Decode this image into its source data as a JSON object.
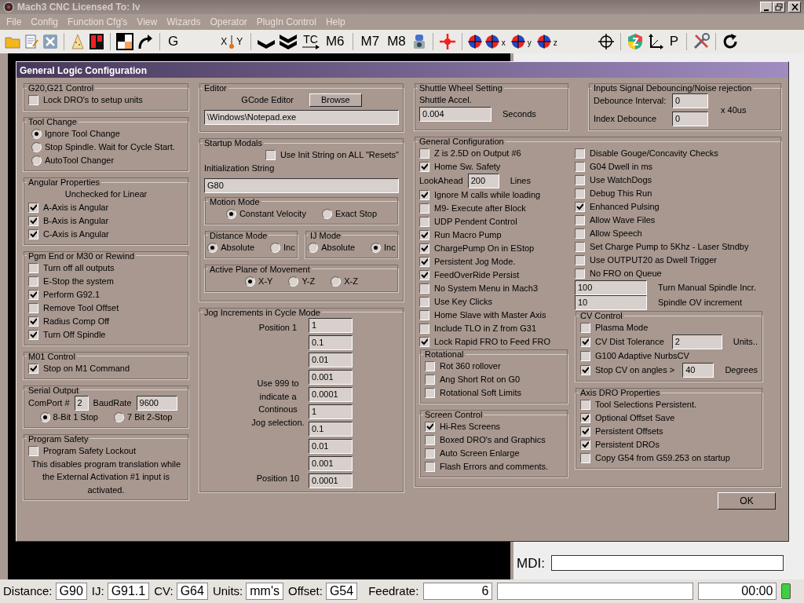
{
  "app": {
    "title": "Mach3 CNC  Licensed To: lv",
    "menu": [
      "File",
      "Config",
      "Function Cfg's",
      "View",
      "Wizards",
      "Operator",
      "PlugIn Control",
      "Help"
    ],
    "toolbar_texts": [
      "G",
      "X",
      "Y",
      "TC",
      "M6",
      "M7",
      "M8",
      "x",
      "y",
      "z",
      "P"
    ]
  },
  "dialog": {
    "title": "General Logic Configuration",
    "columns": [
      [
        {
          "title": "G20,G21 Control",
          "items": [
            {
              "kind": "check",
              "label": "Lock DRO's to setup units",
              "checked": false
            }
          ]
        },
        {
          "title": "Tool Change",
          "items": [
            {
              "kind": "radio",
              "label": "Ignore Tool Change",
              "selected": true
            },
            {
              "kind": "radio",
              "label": "Stop Spindle. Wait for Cycle Start.",
              "selected": false
            },
            {
              "kind": "radio",
              "label": "AutoTool Changer",
              "selected": false
            }
          ]
        },
        {
          "title": "Angular Properties",
          "items": [
            {
              "kind": "note",
              "text": "Unchecked for Linear"
            },
            {
              "kind": "check",
              "label": "A-Axis is Angular",
              "checked": true
            },
            {
              "kind": "check",
              "label": "B-Axis is Angular",
              "checked": true
            },
            {
              "kind": "check",
              "label": "C-Axis is Angular",
              "checked": true
            }
          ]
        },
        {
          "title": "Pgm End or M30 or Rewind",
          "items": [
            {
              "kind": "check",
              "label": "Turn off all outputs",
              "checked": false
            },
            {
              "kind": "check",
              "label": "E-Stop the system",
              "checked": false
            },
            {
              "kind": "check",
              "label": "Perform G92.1",
              "checked": true
            },
            {
              "kind": "check",
              "label": "Remove Tool Offset",
              "checked": false
            },
            {
              "kind": "check",
              "label": "Radius Comp Off",
              "checked": true
            },
            {
              "kind": "check",
              "label": "Turn Off Spindle",
              "checked": true
            }
          ]
        },
        {
          "title": "M01 Control",
          "items": [
            {
              "kind": "check",
              "label": "Stop on M1 Command",
              "checked": true
            }
          ]
        },
        {
          "title": "Serial Output",
          "items": [
            {
              "kind": "fieldrow",
              "fields": [
                {
                  "label": "ComPort #",
                  "value": "2"
                },
                {
                  "label": "BaudRate",
                  "value": "9600"
                }
              ]
            },
            {
              "kind": "radiorow",
              "options": [
                {
                  "label": "8-Bit 1 Stop",
                  "selected": true
                },
                {
                  "label": "7 Bit 2-Stop",
                  "selected": false
                }
              ]
            }
          ]
        },
        {
          "title": "Program Safety",
          "items": [
            {
              "kind": "check",
              "label": "Program Safety Lockout",
              "checked": false
            },
            {
              "kind": "note",
              "text": "This disables program translation while the External Activation #1 input is activated."
            }
          ]
        }
      ],
      [
        {
          "title": "Editor",
          "items": [
            {
              "kind": "buttonrow",
              "label": "GCode Editor",
              "button": "Browse"
            },
            {
              "kind": "input",
              "value": "\\Windows\\Notepad.exe"
            }
          ]
        },
        {
          "title": "Startup Modals",
          "items": [
            {
              "kind": "endcheck",
              "label": "Use Init String on ALL  \"Resets\"",
              "checked": false
            },
            {
              "kind": "label",
              "text": "Initialization String"
            },
            {
              "kind": "input",
              "value": "G80"
            },
            {
              "kind": "group",
              "title": "Motion Mode",
              "items": [
                {
                  "kind": "radiorow",
                  "options": [
                    {
                      "label": "Constant Velocity",
                      "selected": true
                    },
                    {
                      "label": "Exact Stop",
                      "selected": false
                    }
                  ]
                }
              ]
            },
            {
              "kind": "groups",
              "groups": [
                {
                  "title": "Distance Mode",
                  "items": [
                    {
                      "kind": "radiorow",
                      "options": [
                        {
                          "label": "Absolute",
                          "selected": true
                        },
                        {
                          "label": "Inc",
                          "selected": false
                        }
                      ]
                    }
                  ]
                },
                {
                  "title": "IJ Mode",
                  "items": [
                    {
                      "kind": "radiorow",
                      "options": [
                        {
                          "label": "Absolute",
                          "selected": false
                        },
                        {
                          "label": "Inc",
                          "selected": true
                        }
                      ]
                    }
                  ]
                }
              ]
            },
            {
              "kind": "group",
              "title": "Active Plane of Movement",
              "items": [
                {
                  "kind": "radiorow",
                  "options": [
                    {
                      "label": "X-Y",
                      "selected": true
                    },
                    {
                      "label": "Y-Z",
                      "selected": false
                    },
                    {
                      "label": "X-Z",
                      "selected": false
                    }
                  ]
                }
              ]
            }
          ]
        },
        {
          "title": "Jog Increments in Cycle Mode",
          "kind": "jog",
          "first_label": "Position 1",
          "note": "Use 999 to indicate a Continous Jog selection.",
          "last_label": "Position 10",
          "values": [
            "1",
            "0.1",
            "0.01",
            "0.001",
            "0.0001",
            "1",
            "0.1",
            "0.01",
            "0.001",
            "0.0001"
          ]
        }
      ]
    ],
    "shuttle": {
      "title": "Shuttle Wheel Setting",
      "items": [
        {
          "kind": "label",
          "text": "Shuttle Accel."
        },
        {
          "kind": "field",
          "value": "0.004",
          "unit": "Seconds"
        }
      ]
    },
    "debounce": {
      "title": "Inputs Signal Debouncing/Noise rejection",
      "items": [
        {
          "kind": "fieldpair",
          "fields": [
            {
              "label": "Debounce Interval:",
              "value": "0"
            },
            {
              "label": "Index Debounce",
              "value": "0"
            }
          ],
          "unit": "x 40us"
        }
      ]
    },
    "general": {
      "title": "General Configuration",
      "columns": [
        [
          {
            "kind": "check",
            "label": "Z is 2.5D on Output #6",
            "checked": false
          },
          {
            "kind": "check",
            "label": "Home Sw. Safety",
            "checked": true
          },
          {
            "kind": "field",
            "label": "LookAhead",
            "value": "200",
            "unit": "Lines"
          },
          {
            "kind": "check",
            "label": "Ignore M calls while loading",
            "checked": true
          },
          {
            "kind": "check",
            "label": "M9- Execute after Block",
            "checked": false
          },
          {
            "kind": "check",
            "label": "UDP Pendent Control",
            "checked": false
          },
          {
            "kind": "check",
            "label": "Run Macro Pump",
            "checked": true
          },
          {
            "kind": "check",
            "label": "ChargePump On in EStop",
            "checked": true
          },
          {
            "kind": "check",
            "label": "Persistent Jog Mode.",
            "checked": true
          },
          {
            "kind": "check",
            "label": "FeedOverRide Persist",
            "checked": true
          },
          {
            "kind": "check",
            "label": "No System Menu in Mach3",
            "checked": false
          },
          {
            "kind": "check",
            "label": "Use Key Clicks",
            "checked": false
          },
          {
            "kind": "check",
            "label": "Home Slave with Master Axis",
            "checked": false
          },
          {
            "kind": "check",
            "label": "Include TLO in Z from G31",
            "checked": false
          },
          {
            "kind": "check",
            "label": "Lock Rapid FRO to Feed FRO",
            "checked": true
          },
          {
            "kind": "group",
            "title": "Rotational",
            "items": [
              {
                "kind": "check",
                "label": "Rot 360 rollover",
                "checked": false
              },
              {
                "kind": "check",
                "label": "Ang Short Rot on G0",
                "checked": false
              },
              {
                "kind": "check",
                "label": "Rotational Soft Limits",
                "checked": false
              }
            ]
          },
          {
            "kind": "group",
            "title": "Screen Control",
            "items": [
              {
                "kind": "check",
                "label": "Hi-Res Screens",
                "checked": true
              },
              {
                "kind": "check",
                "label": "Boxed DRO's and Graphics",
                "checked": false
              },
              {
                "kind": "check",
                "label": "Auto Screen Enlarge",
                "checked": false
              },
              {
                "kind": "check",
                "label": "Flash Errors and comments.",
                "checked": false
              }
            ]
          }
        ],
        [
          {
            "kind": "check",
            "label": "Disable Gouge/Concavity Checks",
            "checked": false
          },
          {
            "kind": "check",
            "label": "G04 Dwell in ms",
            "checked": false
          },
          {
            "kind": "check",
            "label": "Use WatchDogs",
            "checked": false
          },
          {
            "kind": "check",
            "label": "Debug This Run",
            "checked": false
          },
          {
            "kind": "check",
            "label": "Enhanced Pulsing",
            "checked": true
          },
          {
            "kind": "check",
            "label": "Allow Wave Files",
            "checked": false
          },
          {
            "kind": "check",
            "label": "Allow Speech",
            "checked": false
          },
          {
            "kind": "check",
            "label": "Set Charge Pump to 5Khz  - Laser Stndby",
            "checked": false
          },
          {
            "kind": "check",
            "label": "Use OUTPUT20 as Dwell Trigger",
            "checked": false
          },
          {
            "kind": "check",
            "label": "No FRO on Queue",
            "checked": false
          },
          {
            "kind": "field",
            "value": "100",
            "unit": "Turn Manual Spindle Incr."
          },
          {
            "kind": "field",
            "value": "10",
            "unit": "Spindle OV increment"
          },
          {
            "kind": "group",
            "title": "CV Control",
            "items": [
              {
                "kind": "check",
                "label": "Plasma Mode",
                "checked": false
              },
              {
                "kind": "check",
                "label": "CV Dist Tolerance",
                "checked": true,
                "value": "2",
                "unit": "Units.."
              },
              {
                "kind": "check",
                "label": "G100 Adaptive NurbsCV",
                "checked": false
              },
              {
                "kind": "check",
                "label": "Stop CV on angles >",
                "checked": true,
                "value": "40",
                "unit": "Degrees"
              }
            ]
          },
          {
            "kind": "group",
            "title": "Axis DRO Properties",
            "items": [
              {
                "kind": "check",
                "label": "Tool Selections Persistent.",
                "checked": false
              },
              {
                "kind": "check",
                "label": "Optional Offset Save",
                "checked": true
              },
              {
                "kind": "check",
                "label": "Persistent Offsets",
                "checked": true
              },
              {
                "kind": "check",
                "label": "Persistent DROs",
                "checked": true
              },
              {
                "kind": "check",
                "label": "Copy G54 from G59.253 on startup",
                "checked": false
              }
            ]
          }
        ]
      ]
    },
    "ok": "OK"
  },
  "mdi_label": "MDI:",
  "status_bar": {
    "fields": [
      {
        "label": "Distance:",
        "value": "G90"
      },
      {
        "label": "IJ:",
        "value": "G91.1"
      },
      {
        "label": "CV:",
        "value": "G64"
      },
      {
        "label": "Units:",
        "value": "mm's"
      },
      {
        "label": "Offset:",
        "value": "G54"
      }
    ],
    "feedrate_label": "Feedrate:",
    "feedrate": "6",
    "time": "00:00",
    "led_on": true
  }
}
